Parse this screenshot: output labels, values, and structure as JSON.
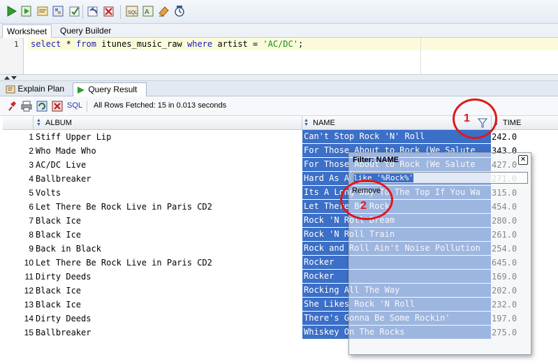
{
  "toolbar": {
    "icons": [
      "run-statement-icon",
      "run-script-icon",
      "autotrace-icon",
      "explain-plan-icon",
      "commit-icon",
      "rollback-icon",
      "unshared-sql-icon",
      "sql-tuning-icon",
      "to-upper-icon",
      "clear-icon",
      "history-icon"
    ]
  },
  "editor_tabs": [
    {
      "label": "Worksheet",
      "active": true
    },
    {
      "label": "Query Builder",
      "active": false
    }
  ],
  "editor": {
    "line_number": "1",
    "tokens": {
      "select": "select",
      "star": " * ",
      "from": "from",
      "table": " itunes_music_raw ",
      "where": "where",
      "col": " artist = ",
      "value": "'AC/DC'",
      "end": ";"
    }
  },
  "result_tabs": [
    {
      "label": "Explain Plan",
      "close": "✕"
    },
    {
      "label": "Query Result",
      "close": "✕"
    }
  ],
  "results_bar": {
    "sql_label": "SQL",
    "status": "All Rows Fetched: 15 in 0.013 seconds"
  },
  "grid": {
    "columns": [
      "ALBUM",
      "NAME",
      "TIME"
    ],
    "rows": [
      {
        "n": "1",
        "album": "Stiff Upper Lip",
        "name": "Can't Stop Rock 'N' Roll",
        "time": "242.0"
      },
      {
        "n": "2",
        "album": "Who Made Who",
        "name": "For Those About to Rock (We Salute",
        "time": "343.0"
      },
      {
        "n": "3",
        "album": "AC/DC Live",
        "name": "For Those About to Rock (We Salute",
        "time": "427.0"
      },
      {
        "n": "4",
        "album": "Ballbreaker",
        "name": "Hard As A Rock",
        "time": "271.0"
      },
      {
        "n": "5",
        "album": "Volts",
        "name": "Its A Long Way To The Top If You Wa",
        "time": "315.0"
      },
      {
        "n": "6",
        "album": "Let There Be Rock Live in Paris CD2",
        "name": "Let There Be Rock",
        "time": "454.0"
      },
      {
        "n": "7",
        "album": "Black Ice",
        "name": "Rock 'N Roll Dream",
        "time": "280.0"
      },
      {
        "n": "8",
        "album": "Black Ice",
        "name": "Rock 'N Roll Train",
        "time": "261.0"
      },
      {
        "n": "9",
        "album": "Back in Black",
        "name": "Rock and Roll Ain't Noise Pollution",
        "time": "254.0"
      },
      {
        "n": "10",
        "album": "Let There Be Rock Live in Paris CD2",
        "name": "Rocker",
        "time": "645.0"
      },
      {
        "n": "11",
        "album": "Dirty Deeds",
        "name": "Rocker",
        "time": "169.0"
      },
      {
        "n": "12",
        "album": "Black Ice",
        "name": "Rocking All The Way",
        "time": "202.0"
      },
      {
        "n": "13",
        "album": "Black Ice",
        "name": "She Likes Rock 'N Roll",
        "time": "232.0"
      },
      {
        "n": "14",
        "album": "Dirty Deeds",
        "name": "There's Gonna Be Some Rockin'",
        "time": "197.0"
      },
      {
        "n": "15",
        "album": "Ballbreaker",
        "name": "Whiskey On The Rocks",
        "time": "275.0"
      }
    ]
  },
  "filter_popup": {
    "title": "Filter: NAME",
    "close": "✕",
    "value": "like '%Rock%'",
    "remove_label": "Remove"
  },
  "annotations": {
    "marker1": "1",
    "marker2": "2",
    "color": "#e01818"
  },
  "colors": {
    "selection": "#3b6fc8"
  }
}
